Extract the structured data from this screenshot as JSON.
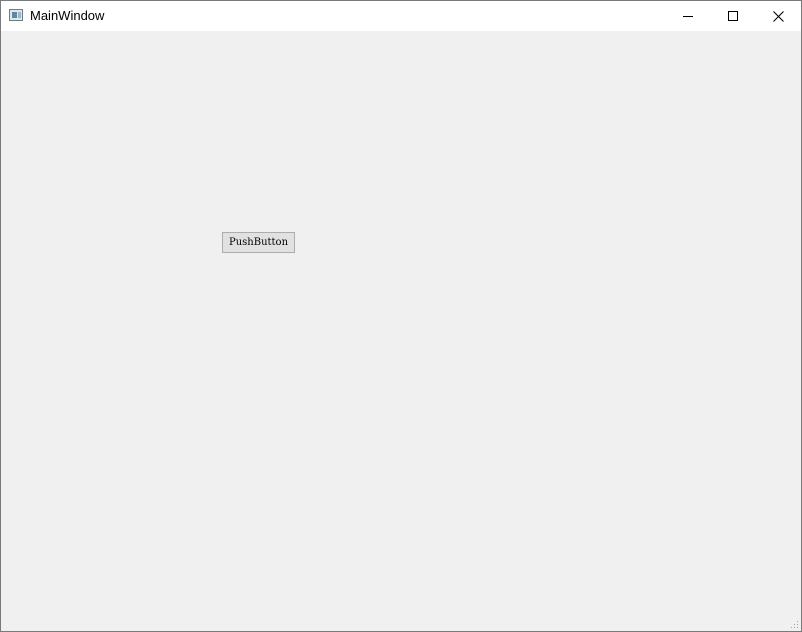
{
  "window": {
    "title": "MainWindow",
    "icon": "app-window-icon",
    "controls": {
      "minimize_icon": "minimize-icon",
      "maximize_icon": "maximize-icon",
      "close_icon": "close-icon"
    }
  },
  "main": {
    "push_button_label": "PushButton"
  },
  "colors": {
    "client_background": "#f0f0f0",
    "titlebar_background": "#ffffff",
    "button_face": "#e1e1e1",
    "button_border": "#adadad"
  }
}
